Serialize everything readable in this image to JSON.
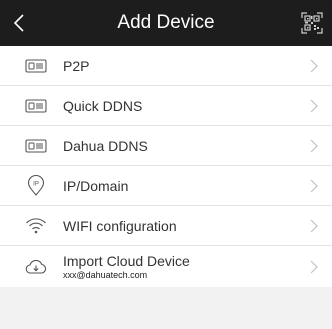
{
  "header": {
    "title": "Add Device",
    "back_icon": "chevron-left-icon",
    "scan_icon": "qr-scan-icon"
  },
  "items": [
    {
      "label": "P2P",
      "icon": "device-recorder-icon"
    },
    {
      "label": "Quick DDNS",
      "icon": "device-recorder-icon"
    },
    {
      "label": "Dahua DDNS",
      "icon": "device-recorder-icon"
    },
    {
      "label": "IP/Domain",
      "icon": "ip-pin-icon"
    },
    {
      "label": "WIFI configuration",
      "icon": "wifi-icon"
    },
    {
      "label": "Import Cloud Device",
      "sub": "xxx@dahuatech.com",
      "icon": "cloud-download-icon"
    }
  ],
  "colors": {
    "header_bg": "#1d1d1d",
    "page_bg": "#f2f2f2",
    "list_bg": "#ffffff",
    "divider": "#e4e4e4"
  }
}
